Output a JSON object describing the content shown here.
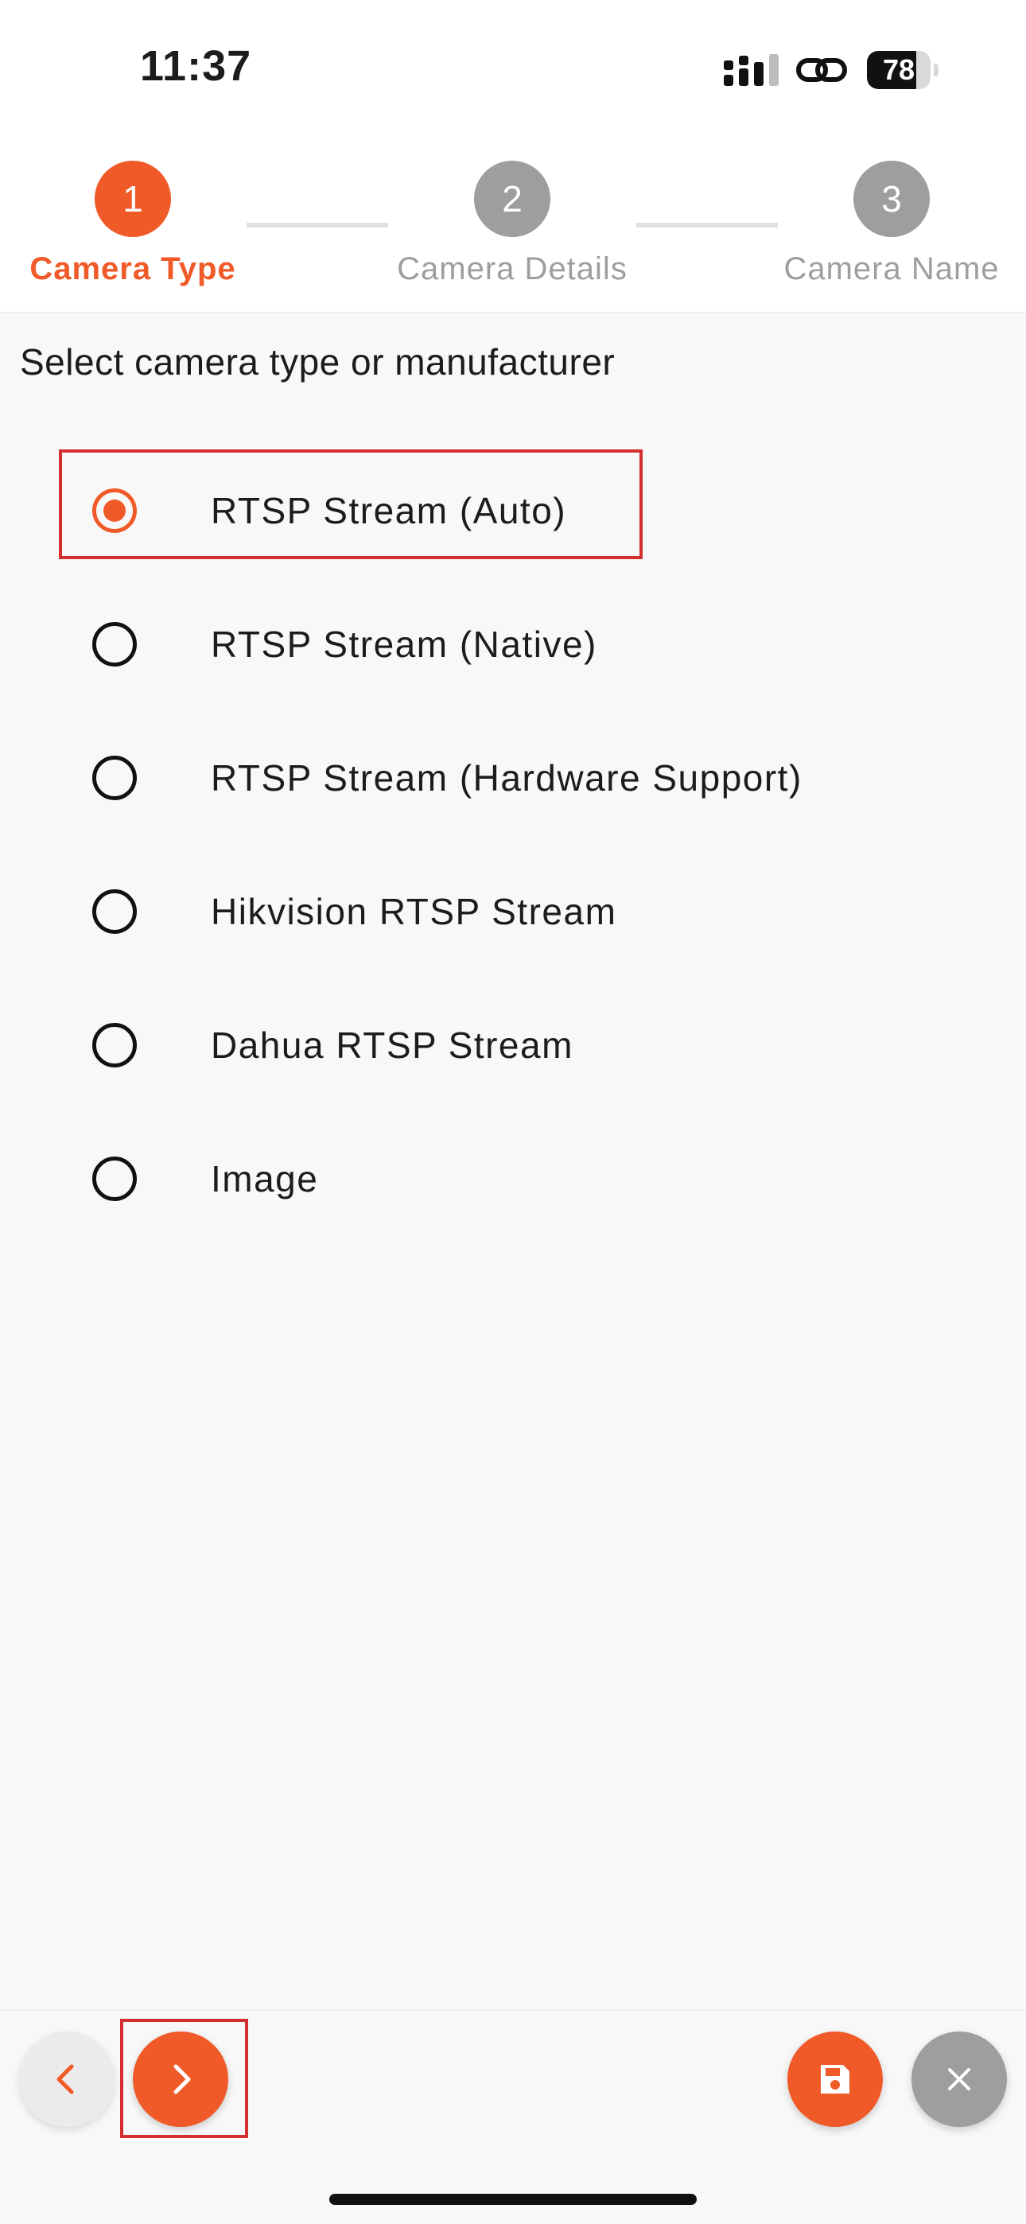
{
  "status_bar": {
    "time": "11:37",
    "battery_percent": "78",
    "icons": [
      "cellular-signal-icon",
      "link-icon",
      "battery-icon"
    ]
  },
  "stepper": {
    "steps": [
      {
        "number": "1",
        "label": "Camera Type",
        "state": "active"
      },
      {
        "number": "2",
        "label": "Camera Details",
        "state": "inactive"
      },
      {
        "number": "3",
        "label": "Camera Name",
        "state": "inactive"
      }
    ]
  },
  "content": {
    "heading": "Select camera type or manufacturer",
    "selected_index": 0,
    "options": [
      {
        "label": "RTSP Stream (Auto)",
        "selected": true
      },
      {
        "label": "RTSP Stream (Native)",
        "selected": false
      },
      {
        "label": "RTSP Stream (Hardware Support)",
        "selected": false
      },
      {
        "label": "Hikvision RTSP Stream",
        "selected": false
      },
      {
        "label": "Dahua RTSP Stream",
        "selected": false
      },
      {
        "label": "Image",
        "selected": false
      }
    ]
  },
  "toolbar": {
    "buttons": [
      "chevron-left-icon",
      "chevron-right-icon",
      "save-icon",
      "close-icon"
    ]
  },
  "colors": {
    "accent": "#f05a28",
    "inactive": "#9e9e9e",
    "highlight": "#d32f2f",
    "background": "#f8f8f8"
  }
}
